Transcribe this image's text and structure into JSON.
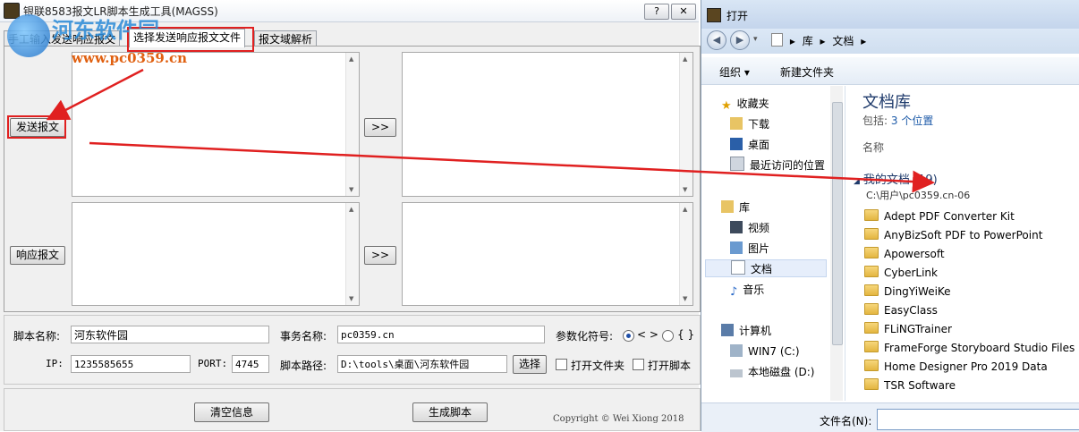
{
  "app": {
    "title": "银联8583报文LR脚本生成工具(MAGSS)",
    "help_label": "?",
    "close_label": "✕",
    "tabs": [
      "手工输入发送响应报文",
      "选择发送响应报文文件",
      "报文域解析"
    ],
    "active_tab": 1,
    "send_button": "发送报文",
    "response_button": "响应报文",
    "arrow_button": ">>",
    "script_name_label": "脚本名称:",
    "script_name_value": "河东软件园",
    "transaction_label": "事务名称:",
    "transaction_value": "pc0359.cn",
    "param_symbol_label": "参数化符号:",
    "param_option_1": "< >",
    "param_option_2": "{ }",
    "ip_label": "IP:",
    "ip_value": "1235585655",
    "port_label": "PORT:",
    "port_value": "4745",
    "path_label": "脚本路径:",
    "path_value": "D:\\tools\\桌面\\河东软件园",
    "browse_button": "选择",
    "open_folder_label": "打开文件夹",
    "open_script_label": "打开脚本",
    "clear_button": "清空信息",
    "generate_button": "生成脚本",
    "copyright": "Copyright © Wei Xiong 2018"
  },
  "watermark": {
    "text": "河东软件园",
    "url": "www.pc0359.cn"
  },
  "dialog": {
    "title": "打开",
    "breadcrumb": [
      "库",
      "文档"
    ],
    "organize_label": "组织 ▾",
    "new_folder_label": "新建文件夹",
    "nav": {
      "favorites_label": "收藏夹",
      "downloads": "下载",
      "desktop": "桌面",
      "recent": "最近访问的位置",
      "libraries_label": "库",
      "videos": "视频",
      "pictures": "图片",
      "documents": "文档",
      "music": "音乐",
      "computer_label": "计算机",
      "drive_c": "WIN7 (C:)",
      "drive_d": "本地磁盘 (D:)"
    },
    "library_title": "文档库",
    "library_sub_prefix": "包括:",
    "library_sub_link": "3 个位置",
    "column_header": "名称",
    "group_label": "我的文档 (19)",
    "group_path": "C:\\用户\\pc0359.cn-06",
    "files": [
      "Adept PDF Converter Kit",
      "AnyBizSoft PDF to PowerPoint",
      "Apowersoft",
      "CyberLink",
      "DingYiWeiKe",
      "EasyClass",
      "FLiNGTrainer",
      "FrameForge Storyboard Studio Files",
      "Home Designer Pro 2019 Data",
      "TSR Software"
    ],
    "filename_label": "文件名(N):",
    "filename_value": ""
  },
  "colors": {
    "annotation_red": "#e02020",
    "link_blue": "#1c5aa8",
    "watermark_blue": "#2a8bd8",
    "watermark_orange": "#e06010"
  }
}
